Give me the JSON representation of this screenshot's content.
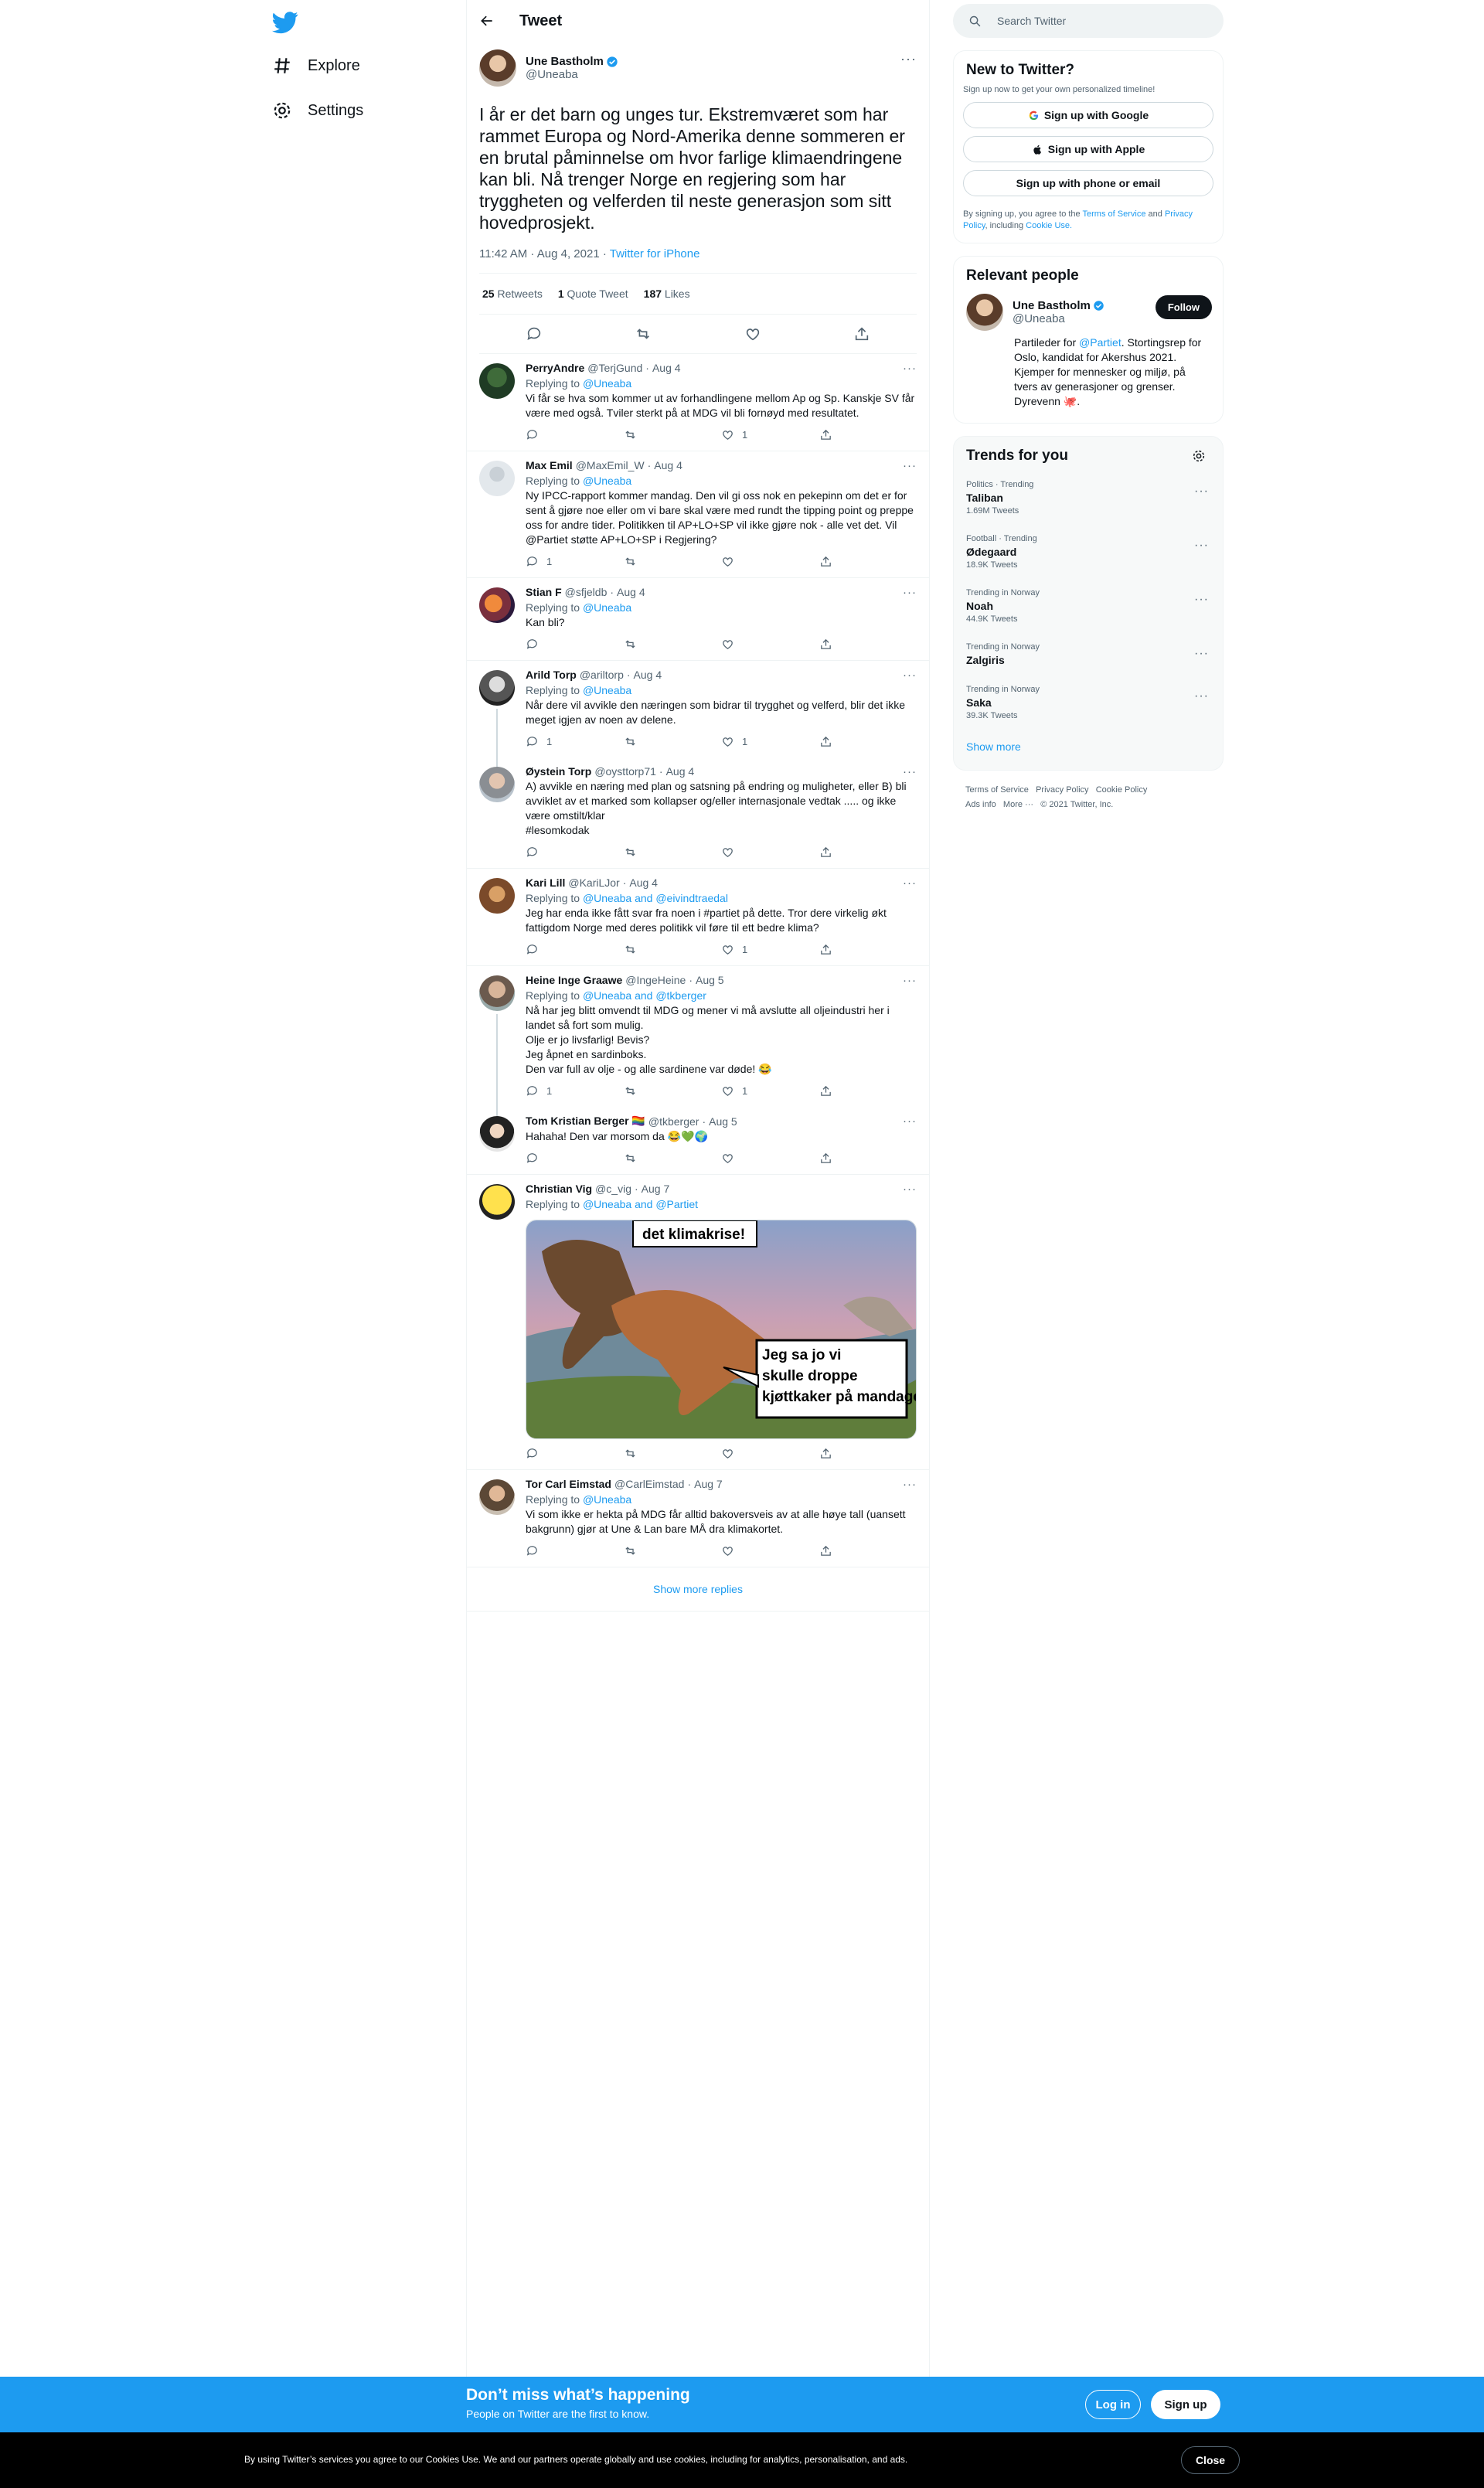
{
  "nav": {
    "items": [
      {
        "label": "Explore",
        "icon": "hash-icon"
      },
      {
        "label": "Settings",
        "icon": "gear-icon"
      }
    ]
  },
  "header": {
    "title": "Tweet"
  },
  "tweet": {
    "name": "Une Bastholm",
    "handle": "@Uneaba",
    "text": "I år er det barn og unges tur. Ekstremværet som har rammet Europa og Nord-Amerika denne sommeren er en brutal påminnelse om hvor farlige klimaendringene kan bli. Nå trenger Norge en regjering som har tryggheten og velferden til neste generasjon som sitt hovedprosjekt.",
    "time": "11:42 AM · Aug 4, 2021",
    "source": "Twitter for iPhone",
    "retweets": "25",
    "retweets_label": "Retweets",
    "quotes": "1",
    "quotes_label": "Quote Tweet",
    "likes": "187",
    "likes_label": "Likes"
  },
  "replies": [
    {
      "name": "PerryAndre",
      "handle": "@TerjGund",
      "date": "Aug 4",
      "replying": "@Uneaba",
      "text": "Vi får se hva som kommer ut av forhandlingene mellom Ap og Sp.  Kanskje SV får være med også. Tviler sterkt på at MDG vil bli fornøyd med resultatet.",
      "replies": "",
      "retweets": "",
      "likes": "1"
    },
    {
      "name": "Max Emil",
      "handle": "@MaxEmil_W",
      "date": "Aug 4",
      "replying": "@Uneaba",
      "text": "Ny IPCC-rapport kommer mandag. Den vil gi oss nok en pekepinn om det er for sent å gjøre noe eller om vi bare skal være med rundt the tipping point og preppe oss for andre tider. Politikken til AP+LO+SP vil ikke gjøre nok - alle vet det. Vil @Partiet  støtte AP+LO+SP i Regjering?",
      "replies": "1",
      "retweets": "",
      "likes": ""
    },
    {
      "name": "Stian F",
      "handle": "@sfjeldb",
      "date": "Aug 4",
      "replying": "@Uneaba",
      "text": "Kan bli?",
      "replies": "",
      "retweets": "",
      "likes": ""
    },
    {
      "name": "Arild Torp",
      "handle": "@ariltorp",
      "date": "Aug 4",
      "replying": "@Uneaba",
      "text": "Når dere vil avvikle den næringen som bidrar til trygghet og velferd, blir det ikke meget igjen av noen av delene.",
      "replies": "1",
      "retweets": "",
      "likes": "1"
    },
    {
      "name": "Øystein Torp",
      "handle": "@oysttorp71",
      "date": "Aug 4",
      "replying": "",
      "text": "A) avvikle en næring med plan og satsning på endring og muligheter, eller B) bli avviklet av et marked som kollapser og/eller internasjonale vedtak ..... og ikke være omstilt/klar\n#lesomkodak",
      "replies": "",
      "retweets": "",
      "likes": ""
    },
    {
      "name": "Kari Lill",
      "handle": "@KariLJor",
      "date": "Aug 4",
      "replying": "@Uneaba and @eivindtraedal",
      "text": "Jeg har enda ikke fått svar fra noen i #partiet på dette. Tror dere virkelig økt fattigdom Norge med deres politikk vil føre til ett bedre klima?",
      "replies": "",
      "retweets": "",
      "likes": "1"
    },
    {
      "name": "Heine Inge Graawe",
      "handle": "@IngeHeine",
      "date": "Aug 5",
      "replying": "@Uneaba and @tkberger",
      "text": "Nå har jeg blitt omvendt til MDG og mener vi må avslutte all oljeindustri her i landet så fort som mulig.\nOlje er jo livsfarlig! Bevis?\nJeg åpnet en sardinboks.\nDen var full av olje - og alle sardinene var døde! 😂",
      "replies": "1",
      "retweets": "",
      "likes": "1"
    },
    {
      "name": "Tom Kristian Berger 🏳️‍🌈",
      "handle": "@tkberger",
      "date": "Aug 5",
      "replying": "",
      "text": "Hahaha! Den var morsom da 😂💚🌍",
      "replies": "",
      "retweets": "",
      "likes": ""
    },
    {
      "name": "Christian Vig",
      "handle": "@c_vig",
      "date": "Aug 7",
      "replying": "@Uneaba and @Partiet",
      "text": "",
      "replies": "",
      "retweets": "",
      "likes": ""
    },
    {
      "name": "Tor Carl Eimstad",
      "handle": "@CarlEimstad",
      "date": "Aug 7",
      "replying": "@Uneaba",
      "text": "Vi som ikke er hekta på MDG får alltid bakoversveis av at alle høye tall (uansett bakgrunn) gjør at Une & Lan bare MÅ dra klimakortet.",
      "replies": "",
      "retweets": "",
      "likes": ""
    }
  ],
  "meme": {
    "top_text": "det klimakrise!",
    "bubble_text": "Jeg sa jo vi skulle droppe kjøttkaker på mandagene"
  },
  "replying_to_label": "Replying to",
  "show_more_replies": "Show more replies",
  "search": {
    "placeholder": "Search Twitter"
  },
  "new_to_twitter": {
    "title": "New to Twitter?",
    "subtitle": "Sign up now to get your own personalized timeline!",
    "google": "Sign up with Google",
    "apple": "Sign up with Apple",
    "phone": "Sign up with phone or email",
    "legal_1": "By signing up, you agree to the",
    "tos": "Terms of Service",
    "legal_2": "and",
    "privacy": "Privacy Policy",
    "legal_3": ", including",
    "cookie": "Cookie Use."
  },
  "relevant": {
    "title": "Relevant people",
    "name": "Une Bastholm",
    "handle": "@Uneaba",
    "follow": "Follow",
    "bio_1": "Partileder for",
    "bio_link": "@Partiet",
    "bio_2": ". Stortingsrep for Oslo, kandidat for Akershus 2021. Kjemper for mennesker og miljø, på tvers av generasjoner og grenser. Dyrevenn 🐙."
  },
  "trends": {
    "title": "Trends for you",
    "items": [
      {
        "meta": "Politics · Trending",
        "name": "Taliban",
        "count": "1.69M Tweets"
      },
      {
        "meta": "Football · Trending",
        "name": "Ødegaard",
        "count": "18.9K Tweets"
      },
      {
        "meta": "Trending in Norway",
        "name": "Noah",
        "count": "44.9K Tweets"
      },
      {
        "meta": "Trending in Norway",
        "name": "Zalgiris",
        "count": ""
      },
      {
        "meta": "Trending in Norway",
        "name": "Saka",
        "count": "39.3K Tweets"
      }
    ],
    "show_more": "Show more"
  },
  "footer": {
    "links": [
      "Terms of Service",
      "Privacy Policy",
      "Cookie Policy",
      "Ads info",
      "More ···",
      "© 2021 Twitter, Inc."
    ]
  },
  "banner": {
    "title": "Don’t miss what’s happening",
    "subtitle": "People on Twitter are the first to know.",
    "login": "Log in",
    "signup": "Sign up"
  },
  "cookie_bar": {
    "text": "By using Twitter’s services you agree to our Cookies Use. We and our partners operate globally and use cookies, including for analytics, personalisation, and ads.",
    "close": "Close"
  },
  "colors": {
    "accent": "#1d9bf0",
    "text": "#0f1419",
    "muted": "#536471",
    "border": "#eff3f4"
  }
}
